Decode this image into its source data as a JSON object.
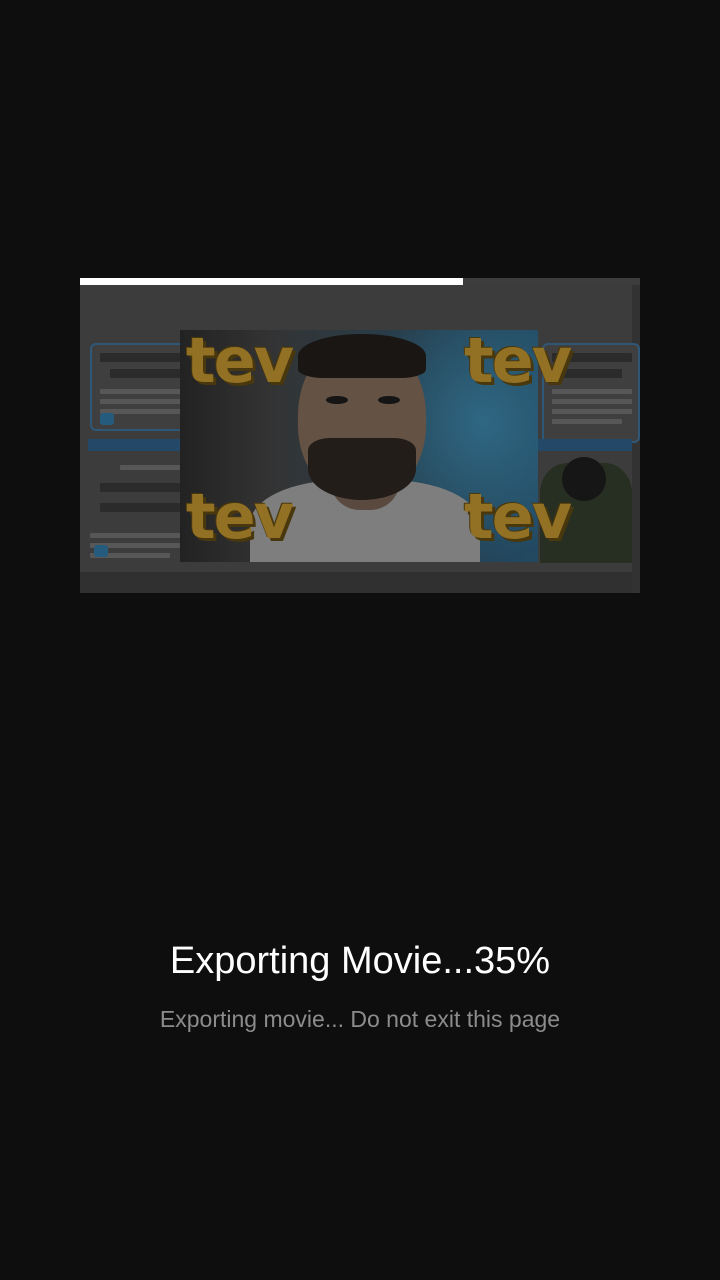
{
  "export": {
    "title": "Exporting Movie...35%",
    "subtitle": "Exporting movie... Do not exit this page",
    "progress_fraction": 0.35
  },
  "preview": {
    "watermark_text": "tev"
  },
  "colors": {
    "background": "#0e0e0e",
    "progress_border": "#ffffff",
    "subtitle_text": "#8c8c8c",
    "watermark": "#b38a2d"
  }
}
